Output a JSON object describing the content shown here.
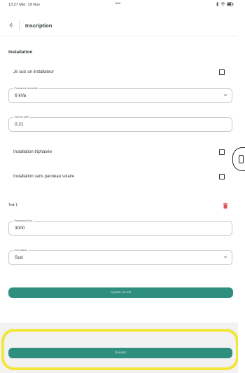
{
  "status_bar": {
    "time": "13:27  Mer. 19 Nov",
    "dots": "•••"
  },
  "header": {
    "title": "Inscription"
  },
  "section": {
    "title": "Installation"
  },
  "checkboxes": {
    "installer_label": "Je suis un installateur",
    "triphase_label": "Installation triphasée",
    "no_panel_label": "Installation sans panneau solaire"
  },
  "fields": {
    "puissance_souscrite": {
      "label": "Puissance souscrite",
      "value": "6 kVa"
    },
    "tarif_kwh": {
      "label": "Tarif du kWh",
      "value": "0,21"
    },
    "puissance_kc": {
      "label": "Puissance (Kc)",
      "value": "3000"
    },
    "orientation": {
      "label": "Orientation",
      "value": "Sud"
    }
  },
  "roof": {
    "title": "Toit 1"
  },
  "buttons": {
    "add_roof": "Ajouter un toit",
    "next": "Suivant"
  },
  "colors": {
    "accent": "#2f8f7f",
    "delete": "#d9534f",
    "highlight": "#f3e53a"
  }
}
